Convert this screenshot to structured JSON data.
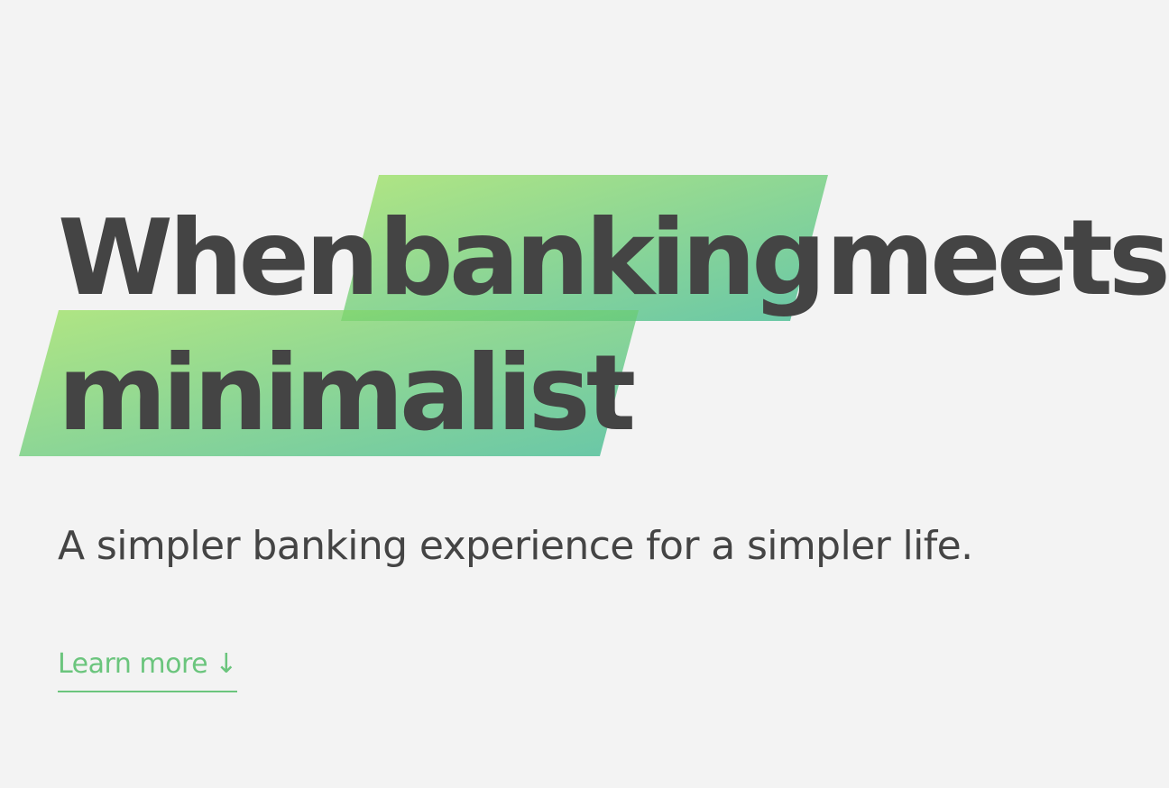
{
  "hero": {
    "title_line1": {
      "word1": "When",
      "word2": "banking",
      "word3": "meets"
    },
    "title_line2": {
      "word1": "minimalist"
    },
    "subtitle": "A simpler banking experience for a simpler life.",
    "cta": {
      "label": "Learn more",
      "icon": "arrow-down-icon",
      "icon_glyph": "↓"
    }
  },
  "colors": {
    "background": "#f3f3f3",
    "text": "#444444",
    "accent": "#6bc57d",
    "highlight_gradient_start": "#9be15d",
    "highlight_gradient_end": "#3ab88f"
  }
}
